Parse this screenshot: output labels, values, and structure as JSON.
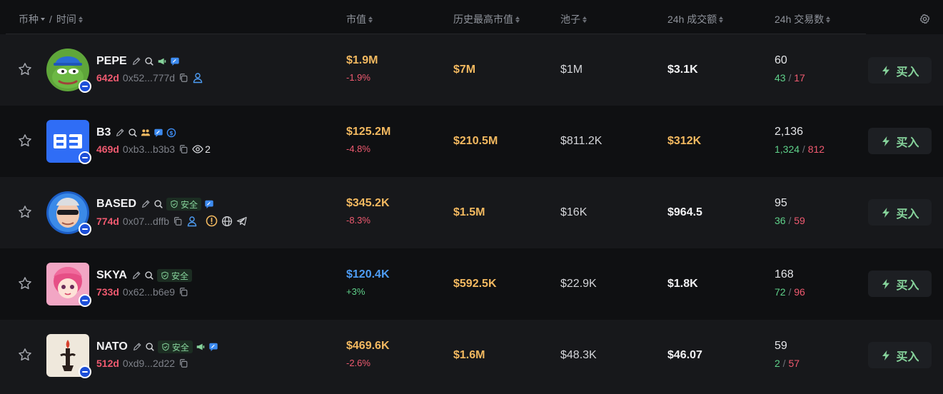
{
  "header": {
    "coin": "币种",
    "time": "时间",
    "mcap": "市值",
    "ath": "历史最高市值",
    "pool": "池子",
    "volume": "24h 成交额",
    "txs": "24h 交易数"
  },
  "buy_label": "买入",
  "safe_label": "安全",
  "rows": [
    {
      "symbol": "PEPE",
      "age": "642d",
      "address": "0x52...777d",
      "mcap": "$1.9M",
      "change": "-1.9%",
      "ath": "$7M",
      "pool": "$1M",
      "volume": "$3.1K",
      "txs": "60",
      "buys": "43",
      "sells": "17"
    },
    {
      "symbol": "B3",
      "age": "469d",
      "address": "0xb3...b3b3",
      "watchers": "2",
      "mcap": "$125.2M",
      "change": "-4.8%",
      "ath": "$210.5M",
      "pool": "$811.2K",
      "volume": "$312K",
      "txs": "2,136",
      "buys": "1,324",
      "sells": "812"
    },
    {
      "symbol": "BASED",
      "age": "774d",
      "address": "0x07...dffb",
      "mcap": "$345.2K",
      "change": "-8.3%",
      "ath": "$1.5M",
      "pool": "$16K",
      "volume": "$964.5",
      "txs": "95",
      "buys": "36",
      "sells": "59"
    },
    {
      "symbol": "SKYA",
      "age": "733d",
      "address": "0x62...b6e9",
      "mcap": "$120.4K",
      "change": "+3%",
      "ath": "$592.5K",
      "pool": "$22.9K",
      "volume": "$1.8K",
      "txs": "168",
      "buys": "72",
      "sells": "96"
    },
    {
      "symbol": "NATO",
      "age": "512d",
      "address": "0xd9...2d22",
      "mcap": "$469.6K",
      "change": "-2.6%",
      "ath": "$1.6M",
      "pool": "$48.3K",
      "volume": "$46.07",
      "txs": "59",
      "buys": "2",
      "sells": "57"
    }
  ],
  "colors": {
    "accent_green": "#86d39b",
    "negative": "#f05a70",
    "positive": "#5fd18a",
    "mcap": "#f3b960",
    "blue": "#4e9df5"
  }
}
